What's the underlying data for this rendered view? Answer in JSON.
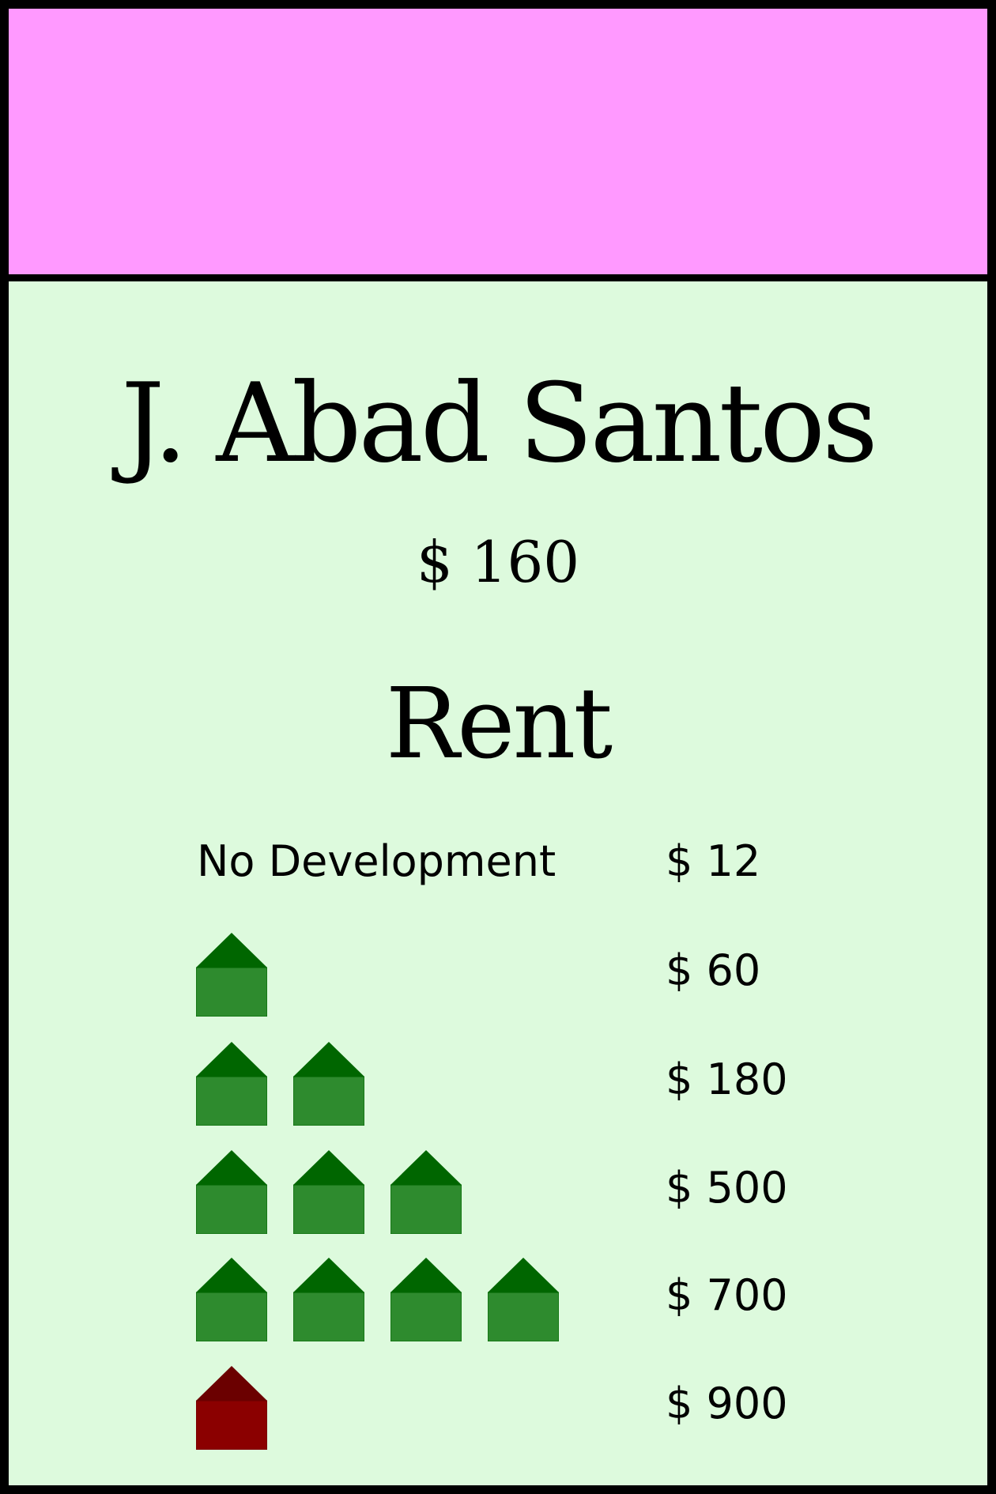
{
  "property": {
    "name": "J. Abad Santos",
    "price": "$ 160",
    "color_band": "#ff99ff",
    "card_background": "#ddfadd"
  },
  "rent": {
    "heading": "Rent",
    "rows": [
      {
        "label": "No Development",
        "houses": 0,
        "hotel": false,
        "value": "$ 12"
      },
      {
        "label": "",
        "houses": 1,
        "hotel": false,
        "value": "$ 60"
      },
      {
        "label": "",
        "houses": 2,
        "hotel": false,
        "value": "$ 180"
      },
      {
        "label": "",
        "houses": 3,
        "hotel": false,
        "value": "$ 500"
      },
      {
        "label": "",
        "houses": 4,
        "hotel": false,
        "value": "$ 700"
      },
      {
        "label": "",
        "houses": 0,
        "hotel": true,
        "value": "$ 900"
      }
    ]
  },
  "icons": {
    "house": {
      "name": "green-house-icon",
      "roof": "#006600",
      "body": "#2e8b2e"
    },
    "hotel": {
      "name": "red-hotel-icon",
      "roof": "#6b0000",
      "body": "#8b0000"
    }
  }
}
